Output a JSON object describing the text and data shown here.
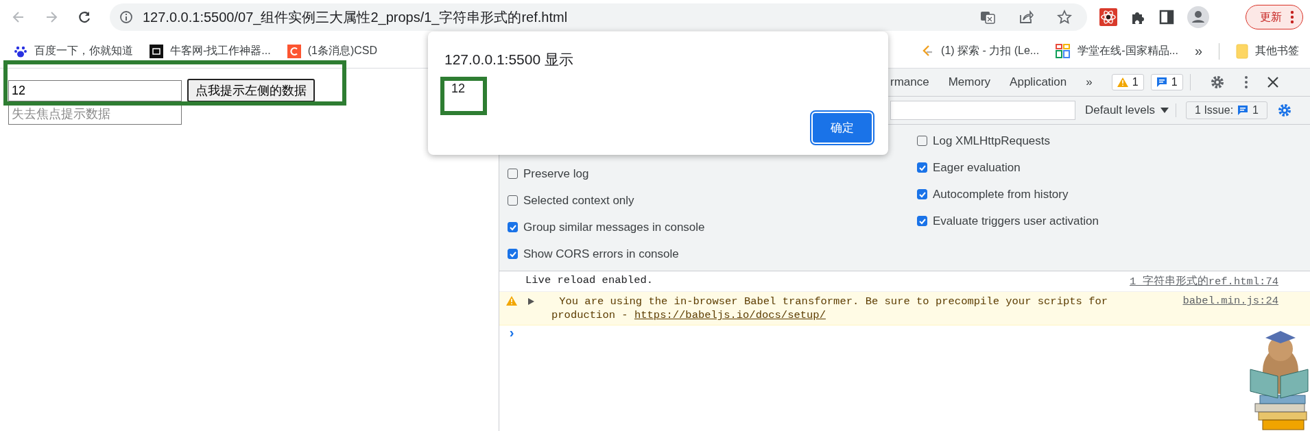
{
  "browser": {
    "nav_buttons": [
      {
        "kind": "back",
        "disabled": true
      },
      {
        "kind": "forward",
        "disabled": true
      },
      {
        "kind": "reload",
        "disabled": false
      }
    ],
    "address_bar": {
      "url": "127.0.0.1:5500/07_组件实例三大属性2_props/1_字符串形式的ref.html"
    },
    "update_button": {
      "label": "更新"
    },
    "bookmarks_left": [
      {
        "kind": "paw",
        "label": "百度一下，你就知道"
      },
      {
        "kind": "dark-square",
        "label": "牛客网-找工作神器..."
      },
      {
        "kind": "red-tile",
        "label": "(1条消息)CSD"
      }
    ],
    "bookmarks_right": [
      {
        "kind": "hook",
        "label": "(1) 探索 - 力扣 (Le..."
      },
      {
        "kind": "grid",
        "label": "学堂在线-国家精品..."
      }
    ],
    "more_bookmarks": "»",
    "other_bookmarks": "其他书签"
  },
  "page": {
    "text_input": {
      "value": "12"
    },
    "button": "点我提示左侧的数据",
    "blur_input": {
      "placeholder": "失去焦点提示数据"
    }
  },
  "alert": {
    "title": "127.0.0.1:5500 显示",
    "message": "12",
    "ok_button": "确定"
  },
  "devtools": {
    "tabs": [
      {
        "label": "rmance",
        "selected": false
      },
      {
        "label": "Memory",
        "selected": false
      },
      {
        "label": "Application",
        "selected": false
      }
    ],
    "more_tabs": "»",
    "warning_count": "1",
    "message_count": "1",
    "levels": "Default levels",
    "issues": {
      "label": "1 Issue:",
      "count": "1"
    },
    "settings_left": [
      {
        "label": "Preserve log",
        "checked": false
      },
      {
        "label": "Selected context only",
        "checked": false
      },
      {
        "label": "Group similar messages in console",
        "checked": true
      },
      {
        "label": "Show CORS errors in console",
        "checked": true
      }
    ],
    "settings_right": [
      {
        "label": "Log XMLHttpRequests",
        "checked": false
      },
      {
        "label": "Eager evaluation",
        "checked": true
      },
      {
        "label": "Autocomplete from history",
        "checked": true
      },
      {
        "label": "Evaluate triggers user activation",
        "checked": true
      }
    ],
    "messages": [
      {
        "kind": "log",
        "text": "Live reload enabled.",
        "source": "1_字符串形式的ref.html:74"
      },
      {
        "kind": "warning",
        "text": "You are using the in-browser Babel transformer. Be sure to precompile your scripts for production - ",
        "link": "https://babeljs.io/docs/setup/",
        "source": "babel.min.js:24"
      }
    ],
    "prompt": "›"
  }
}
